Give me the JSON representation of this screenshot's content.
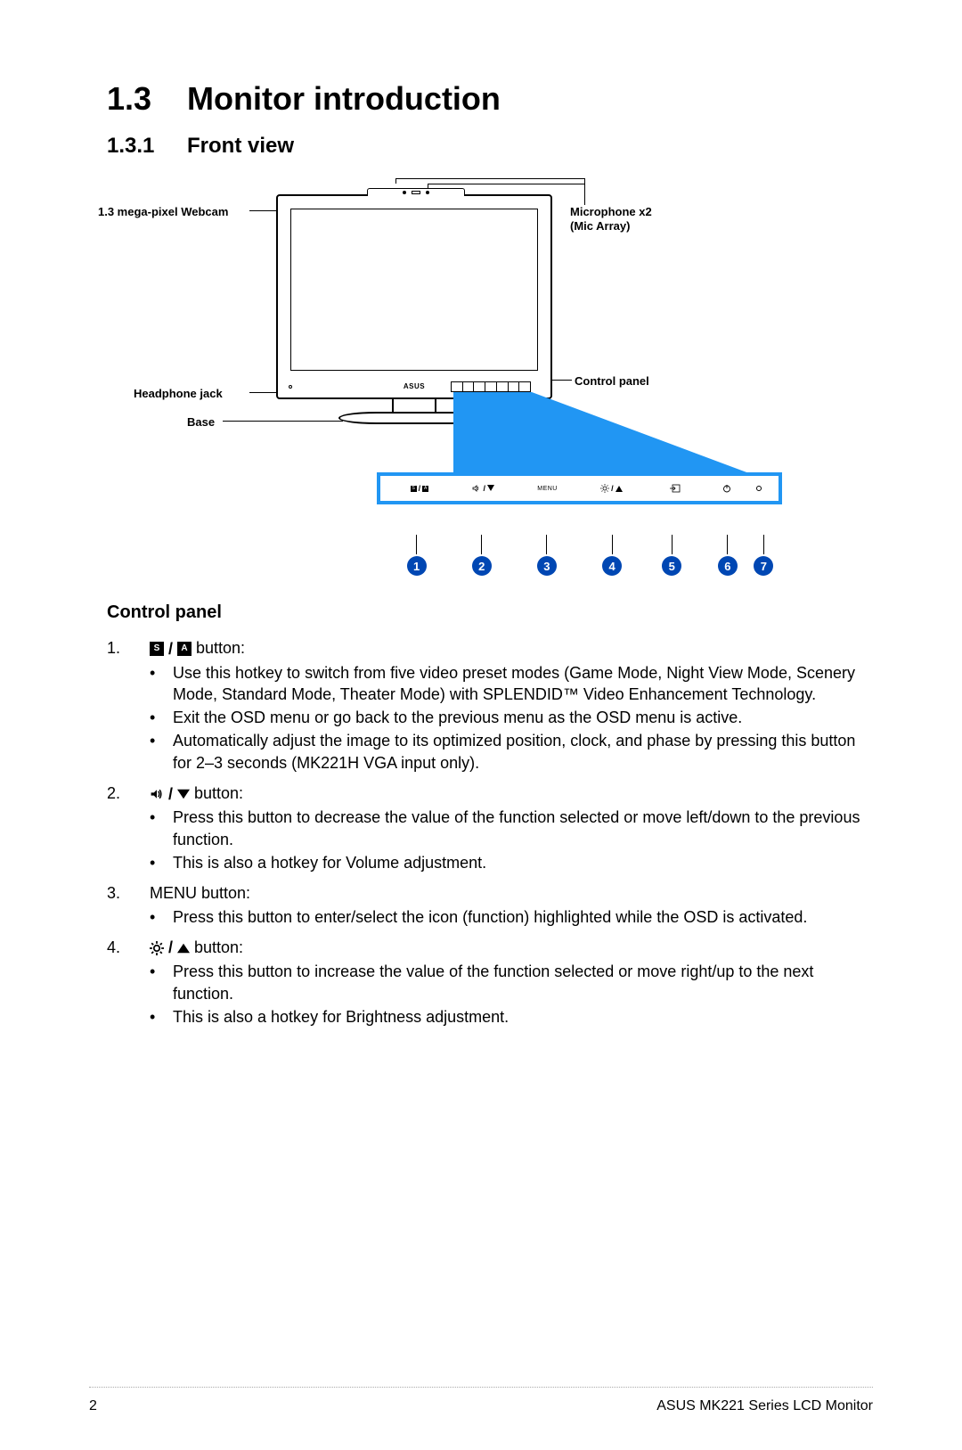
{
  "section": {
    "number": "1.3",
    "title": "Monitor introduction"
  },
  "subsection": {
    "number": "1.3.1",
    "title": "Front view"
  },
  "diagram_labels": {
    "webcam": "1.3 mega-pixel Webcam",
    "mic": "Microphone x2",
    "mic2": "(Mic Array)",
    "control_panel": "Control panel",
    "headphone": "Headphone jack",
    "base": "Base",
    "logo": "ASUS"
  },
  "panel_buttons": {
    "b1_sa": {
      "s": "S",
      "a": "A"
    },
    "b3_menu": "MENU",
    "numbers": [
      "1",
      "2",
      "3",
      "4",
      "5",
      "6",
      "7"
    ]
  },
  "cp_heading": "Control panel",
  "items": [
    {
      "num": "1.",
      "label_suffix": " button:",
      "bullets": [
        "Use this hotkey to switch from five video preset modes (Game Mode, Night View Mode, Scenery Mode, Standard Mode, Theater Mode) with SPLENDID™ Video Enhancement Technology.",
        "Exit the OSD menu or go back to the previous menu as the OSD menu is active.",
        "Automatically adjust the image to its optimized position, clock, and phase by pressing this button for 2–3 seconds (MK221H VGA input only)."
      ]
    },
    {
      "num": "2.",
      "label_suffix": " button:",
      "bullets": [
        "Press this button to decrease the value of the function selected or move left/down to the previous function.",
        "This is also a hotkey for Volume adjustment."
      ]
    },
    {
      "num": "3.",
      "label_text": "MENU button:",
      "bullets": [
        "Press this button to enter/select the icon (function) highlighted while the OSD is activated."
      ]
    },
    {
      "num": "4.",
      "label_suffix": " button:",
      "bullets": [
        "Press this button to increase the value of the function selected or move right/up to the next function.",
        "This is also a hotkey for Brightness adjustment."
      ]
    }
  ],
  "footer": {
    "page": "2",
    "doc": "ASUS MK221 Series LCD Monitor"
  }
}
